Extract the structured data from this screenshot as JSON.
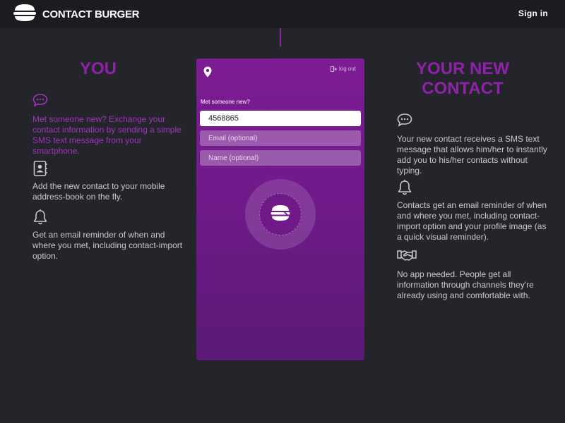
{
  "header": {
    "brand": "CONTACT BURGER",
    "signin_label": "Sign in"
  },
  "left": {
    "title": "YOU",
    "features": [
      {
        "icon": "chat-icon",
        "text": "Met someone new? Exchange your contact information by sending a simple SMS text message from your smartphone."
      },
      {
        "icon": "address-book-icon",
        "text": "Add the new contact to your mobile address-book on the fly."
      },
      {
        "icon": "bell-icon",
        "text": "Get an email reminder of when and where you met, including contact-import option."
      }
    ]
  },
  "phone": {
    "logout_label": "log out",
    "prompt": "Met someone new?",
    "phone_value": "4568865",
    "email_placeholder": "Email (optional)",
    "name_placeholder": "Name (optional)",
    "send_icon": "burger-icon"
  },
  "right": {
    "title_line1": "YOUR NEW",
    "title_line2": "CONTACT",
    "features": [
      {
        "icon": "chat-icon",
        "text": "Your new contact receives a SMS text message that allows him/her to instantly add you to his/her contacts without typing."
      },
      {
        "icon": "bell-icon",
        "text": "Contacts get an email reminder of when and where you met, including contact-import option and your profile image (as a quick visual reminder)."
      },
      {
        "icon": "handshake-icon",
        "text": "No app needed. People get all information through channels they're already using and comfortable with."
      }
    ]
  },
  "colors": {
    "accent": "#8f22a8",
    "background": "#23252b",
    "header": "#1b1c20"
  }
}
